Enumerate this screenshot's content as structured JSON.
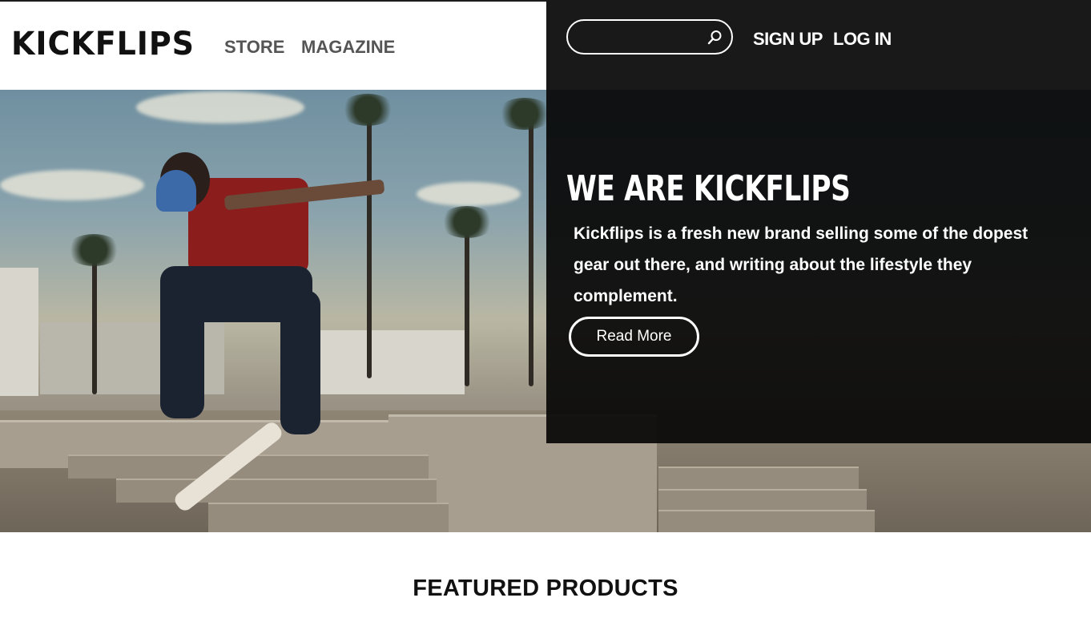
{
  "header": {
    "logo": "KICKFLIPS",
    "nav": [
      {
        "label": "STORE"
      },
      {
        "label": "MAGAZINE"
      }
    ],
    "search": {
      "value": "",
      "placeholder": ""
    },
    "signup_label": "SIGN UP",
    "login_label": "LOG IN"
  },
  "hero": {
    "title": "WE ARE KICKFLIPS",
    "description": "Kickflips is a fresh new brand selling some of the dopest gear out there, and writing about the lifestyle they complement.",
    "button_label": "Read More"
  },
  "featured": {
    "title": "FEATURED PRODUCTS"
  },
  "colors": {
    "overlay": "#080808",
    "nav_text": "#555555",
    "white": "#ffffff"
  },
  "icons": {
    "search": "search-icon"
  }
}
